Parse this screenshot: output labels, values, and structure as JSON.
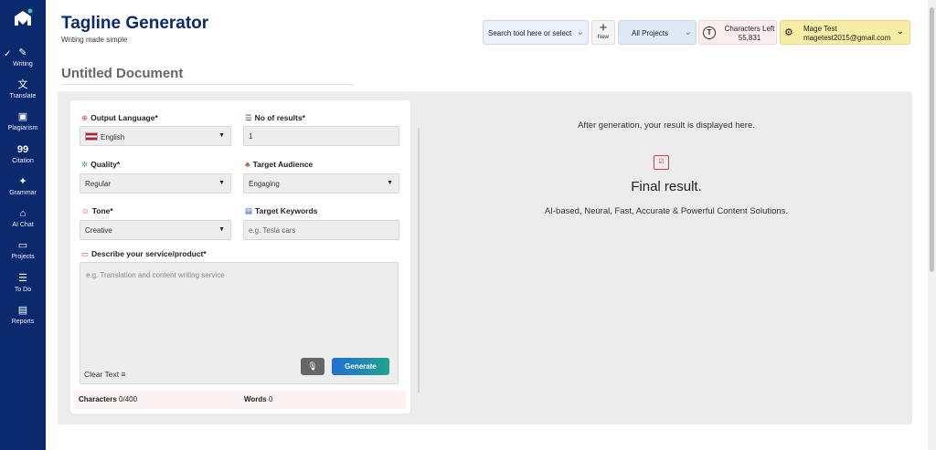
{
  "app": {
    "title": "Tagline Generator",
    "subtitle": "Writing made simple"
  },
  "sidebar": {
    "items": [
      {
        "label": "Writing",
        "icon": "writing-icon"
      },
      {
        "label": "Translate",
        "icon": "translate-icon"
      },
      {
        "label": "Plagiarism",
        "icon": "plagiarism-icon"
      },
      {
        "label": "Citation",
        "icon": "citation-icon",
        "glyph": "99"
      },
      {
        "label": "Grammar",
        "icon": "grammar-icon"
      },
      {
        "label": "AI Chat",
        "icon": "ai-chat-icon"
      },
      {
        "label": "Projects",
        "icon": "folder-icon"
      },
      {
        "label": "To Do",
        "icon": "todo-icon"
      },
      {
        "label": "Reports",
        "icon": "reports-icon"
      }
    ]
  },
  "header": {
    "search_label": "Search tool here or select",
    "new_label": "New",
    "projects_label": "All Projects",
    "chars_label": "Characters Left",
    "chars_value": "55,831",
    "user_name": "Mage Test",
    "user_email": "magetest2015@gmail.com"
  },
  "document": {
    "title": "Untitled Document"
  },
  "form": {
    "output_language_label": "Output Language*",
    "output_language_value": "English",
    "results_label": "No of results*",
    "results_value": "1",
    "quality_label": "Quality*",
    "quality_value": "Regular",
    "audience_label": "Target Audience",
    "audience_value": "Engaging",
    "tone_label": "Tone*",
    "tone_value": "Creative",
    "keywords_label": "Target Keywords",
    "keywords_placeholder": "e.g. Tesla cars",
    "describe_label": "Describe your service/product*",
    "describe_placeholder": "e.g. Translation and content writing service",
    "clear_label": "Clear Text",
    "generate_label": "Generate",
    "characters_label": "Characters",
    "characters_value": "0/400",
    "words_label": "Words",
    "words_value": "0"
  },
  "result": {
    "hint": "After generation, your result is displayed here.",
    "title": "Final result.",
    "subtitle": "AI-based, Neural, Fast, Accurate & Powerful Content Solutions."
  },
  "colors": {
    "sidebar": "#0b2a6e",
    "accent_red": "#d24141",
    "generate_start": "#1f6fd6",
    "generate_end": "#20a38d"
  }
}
